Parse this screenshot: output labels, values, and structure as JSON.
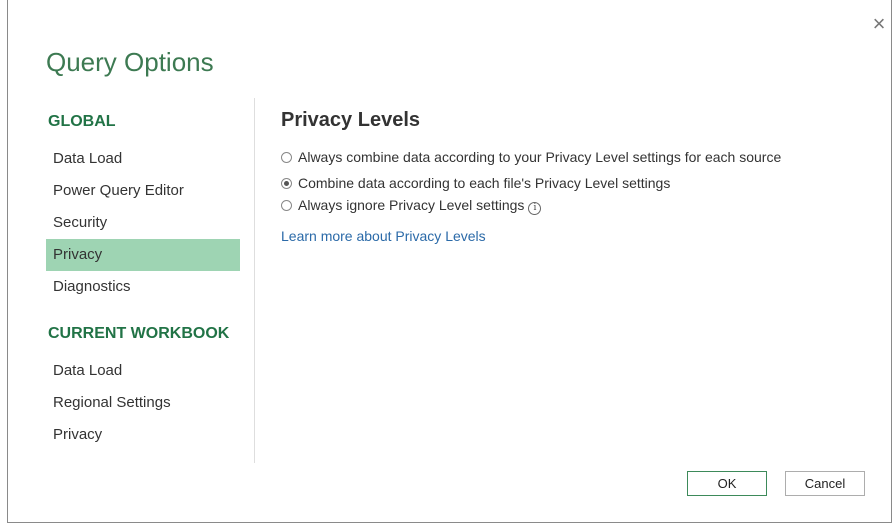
{
  "dialog": {
    "title": "Query Options",
    "close_symbol": "×"
  },
  "sidebar": {
    "global_header": "GLOBAL",
    "global_items": [
      {
        "label": "Data Load",
        "selected": false
      },
      {
        "label": "Power Query Editor",
        "selected": false
      },
      {
        "label": "Security",
        "selected": false
      },
      {
        "label": "Privacy",
        "selected": true
      },
      {
        "label": "Diagnostics",
        "selected": false
      }
    ],
    "workbook_header": "CURRENT WORKBOOK",
    "workbook_items": [
      {
        "label": "Data Load"
      },
      {
        "label": "Regional Settings"
      },
      {
        "label": "Privacy"
      }
    ]
  },
  "content": {
    "heading": "Privacy Levels",
    "options": [
      {
        "label": "Always combine data according to your Privacy Level settings for each source",
        "checked": false
      },
      {
        "label": "Combine data according to each file's Privacy Level settings",
        "checked": true
      },
      {
        "label": "Always ignore Privacy Level settings",
        "checked": false
      }
    ],
    "info_glyph": "i",
    "learn_more": "Learn more about Privacy Levels"
  },
  "buttons": {
    "ok": "OK",
    "cancel": "Cancel"
  },
  "colors": {
    "title_green": "#3d7a52",
    "section_green": "#217346",
    "selected_bg": "#9ed4b3",
    "link_blue": "#2b6aa8"
  }
}
